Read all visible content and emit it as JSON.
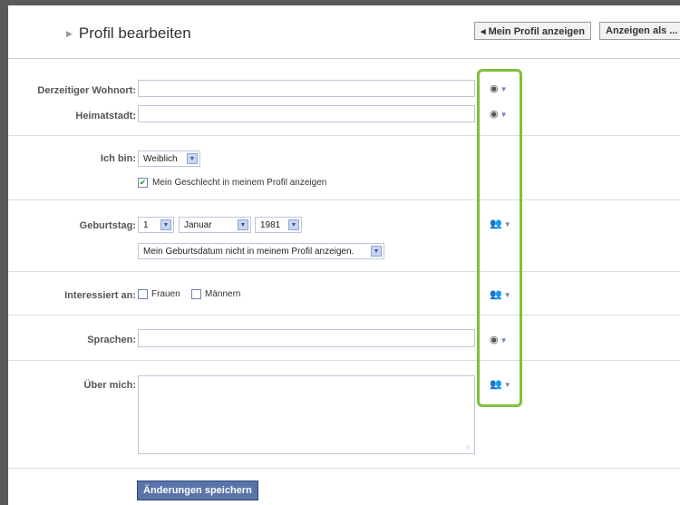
{
  "header": {
    "title": "Profil bearbeiten",
    "view_profile_label": "◂ Mein Profil anzeigen",
    "view_as_label": "Anzeigen als ..."
  },
  "residence": {
    "current_label": "Derzeitiger Wohnort:",
    "hometown_label": "Heimatstadt:",
    "current_value": "",
    "hometown_value": ""
  },
  "gender": {
    "label": "Ich bin:",
    "value": "Weiblich",
    "show_label": "Mein Geschlecht in meinem Profil anzeigen",
    "show_checked": true
  },
  "birthday": {
    "label": "Geburtstag:",
    "day": "1",
    "month": "Januar",
    "year": "1981",
    "visibility": "Mein Geburtsdatum nicht in meinem Profil anzeigen."
  },
  "interested": {
    "label": "Interessiert an:",
    "women": "Frauen",
    "men": "Männern"
  },
  "languages": {
    "label": "Sprachen:",
    "value": ""
  },
  "about": {
    "label": "Über mich:",
    "value": ""
  },
  "save_label": "Änderungen speichern",
  "icons": {
    "public": "globe-icon",
    "friends": "friends-icon",
    "dropdown": "dropdown-arrow-icon"
  },
  "colors": {
    "highlight": "#7ec13a",
    "save_button": "#5b74a8",
    "input_border": "#bdc7d8"
  }
}
